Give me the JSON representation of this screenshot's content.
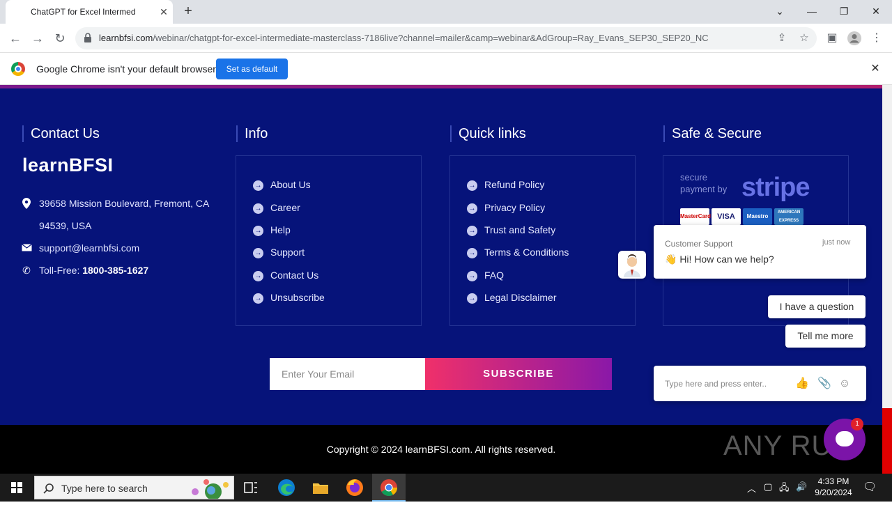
{
  "browser": {
    "tab_title": "ChatGPT for Excel Intermediate Masterclass",
    "url_domain": "learnbfsi.com",
    "url_path": "/webinar/chatgpt-for-excel-intermediate-masterclass-7186live?channel=mailer&camp=webinar&AdGroup=Ray_Evans_SEP30_SEP20_NC",
    "infobar_text": "Google Chrome isn't your default browser",
    "set_default_label": "Set as default"
  },
  "footer": {
    "contact": {
      "heading": "Contact Us",
      "brand": "learnBFSI",
      "address_line1": "39658 Mission Boulevard, Fremont, CA",
      "address_line2": "94539, USA",
      "email": "support@learnbfsi.com",
      "toll_free_label": "Toll-Free: ",
      "toll_free_number": "1800-385-1627"
    },
    "info": {
      "heading": "Info",
      "links": [
        "About Us",
        "Career",
        "Help",
        "Support",
        "Contact Us",
        "Unsubscribe"
      ]
    },
    "quick_links": {
      "heading": "Quick links",
      "links": [
        "Refund Policy",
        "Privacy Policy",
        "Trust and Safety",
        "Terms & Conditions",
        "FAQ",
        "Legal Disclaimer"
      ]
    },
    "secure": {
      "heading": "Safe & Secure",
      "secure_line1": "secure",
      "secure_line2": "payment by",
      "stripe": "stripe",
      "cards": [
        "MasterCard",
        "VISA",
        "Maestro",
        "AMERICAN EXPRESS"
      ]
    },
    "newsletter": {
      "placeholder": "Enter Your Email",
      "button": "SUBSCRIBE"
    },
    "copyright": "Copyright © 2024 learnBFSI.com. All rights reserved.",
    "watermark": "ANY RUN"
  },
  "chat": {
    "agent": "Customer Support",
    "time": "just now",
    "message": "👋 Hi! How can we help?",
    "replies": [
      "I have a question",
      "Tell me more"
    ],
    "input_placeholder": "Type here and press enter..",
    "badge_count": "1"
  },
  "taskbar": {
    "search_placeholder": "Type here to search",
    "time": "4:33 PM",
    "date": "9/20/2024"
  },
  "colors": {
    "page_bg": "#06137a",
    "accent_pink": "#f0306a",
    "accent_purple": "#8a18a8",
    "chrome_blue": "#1a73e8"
  }
}
